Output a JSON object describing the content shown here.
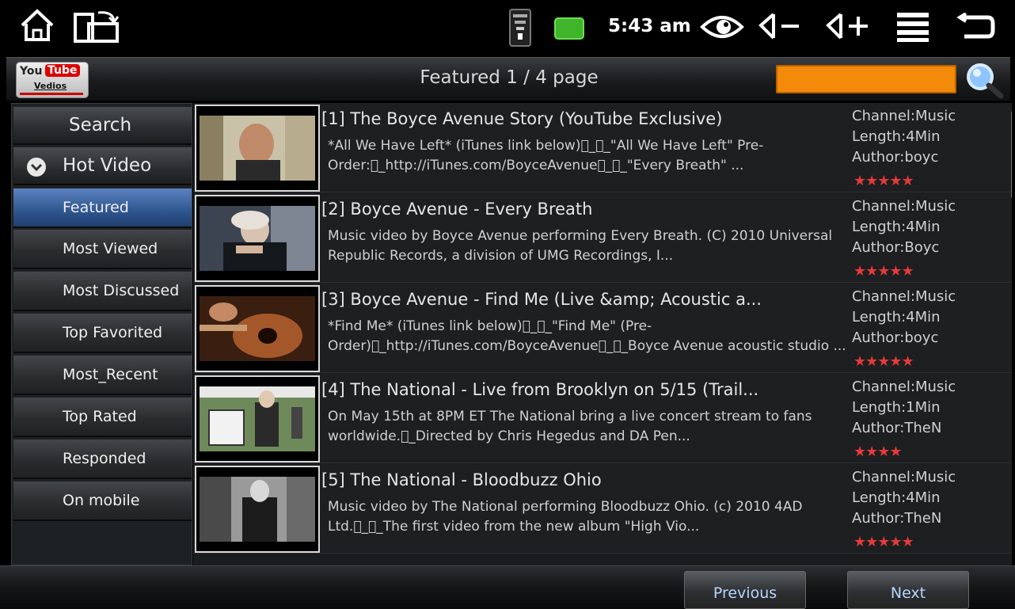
{
  "status_bar": {
    "time": "5:43 am",
    "icons": [
      "home-icon",
      "rotate-screen-icon",
      "wifi-icon",
      "battery-icon",
      "eye-icon",
      "volume-down-icon",
      "volume-up-icon",
      "menu-icon",
      "back-icon"
    ],
    "volume_down_label": "◁−",
    "volume_up_label": "◁+"
  },
  "header": {
    "logo_you": "You",
    "logo_tube": "Tube",
    "logo_sub": "Vedios",
    "title": "Featured 1 / 4 page",
    "search_value": "",
    "search_color": "#f48a0a"
  },
  "sidebar": {
    "search_label": "Search",
    "hot_video_label": "Hot Video",
    "items": [
      {
        "label": "Featured"
      },
      {
        "label": "Most Viewed"
      },
      {
        "label": "Most Discussed"
      },
      {
        "label": "Top Favorited"
      },
      {
        "label": "Most_Recent"
      },
      {
        "label": "Top Rated"
      },
      {
        "label": "Responded"
      },
      {
        "label": "On mobile"
      }
    ],
    "selected_color": "#3a67a8"
  },
  "videos": [
    {
      "title": "[1] The Boyce Avenue Story (YouTube Exclusive)",
      "desc": "*All We Have Left* (iTunes link below)\u0000_\u0000_\"All We Have Left\" Pre-Order:\u0000_http://iTunes.com/BoyceAvenue\u0000_\u0000_\"Every Breath\" ...",
      "channel": "Channel:Music",
      "length": "Length:4Min",
      "author": "Author:boyc",
      "stars": "★★★★★",
      "rating": 5
    },
    {
      "title": "[2] Boyce Avenue - Every Breath",
      "desc": "Music video by Boyce Avenue performing Every Breath. (C) 2010 Universal Republic Records, a division of UMG Recordings, I...",
      "channel": "Channel:Music",
      "length": "Length:4Min",
      "author": "Author:Boyc",
      "stars": "★★★★★",
      "rating": 5
    },
    {
      "title": "[3] Boyce Avenue - Find Me (Live &amp; Acoustic a...",
      "desc": "*Find Me* (iTunes link below)\u0000_\u0000_\"Find Me\" (Pre-Order)\u0000_http://iTunes.com/BoyceAvenue\u0000_\u0000_Boyce Avenue acoustic studio ...",
      "channel": "Channel:Music",
      "length": "Length:4Min",
      "author": "Author:boyc",
      "stars": "★★★★★",
      "rating": 5
    },
    {
      "title": "[4] The National - Live from Brooklyn on 5/15 (Trail...",
      "desc": "On May 15th at 8PM ET The National bring a live concert stream to fans worldwide.\u0000_Directed by Chris Hegedus and DA Pen...",
      "channel": "Channel:Music",
      "length": "Length:1Min",
      "author": "Author:TheN",
      "stars": "★★★★",
      "rating": 4
    },
    {
      "title": "[5] The National - Bloodbuzz Ohio",
      "desc": "Music video by The National performing Bloodbuzz Ohio. (c) 2010 4AD Ltd.\u0000_\u0000_The first video from the new album \"High Vio...",
      "channel": "Channel:Music",
      "length": "Length:4Min",
      "author": "Author:TheN",
      "stars": "★★★★★",
      "rating": 5
    }
  ],
  "footer": {
    "previous_label": "Previous",
    "next_label": "Next"
  }
}
